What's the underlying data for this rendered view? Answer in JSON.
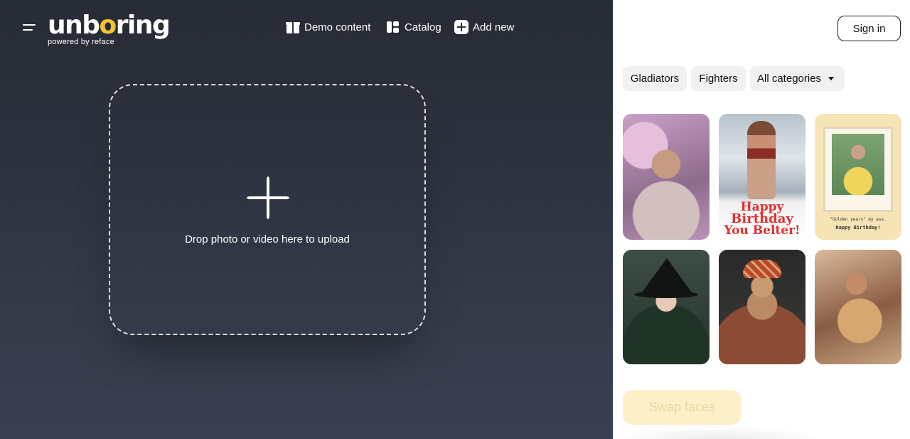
{
  "header": {
    "logo": {
      "word_start": "unb",
      "word_o": "o",
      "word_end": "ring",
      "tagline": "powered by reface"
    },
    "nav": [
      {
        "label": "Demo content",
        "icon": "gift-icon"
      },
      {
        "label": "Catalog",
        "icon": "catalog-grid-icon"
      },
      {
        "label": "Add new",
        "icon": "add-square-icon"
      }
    ],
    "sign_in_label": "Sign in"
  },
  "upload": {
    "text": "Drop photo or video here to upload",
    "icon": "plus-sparkle-icon"
  },
  "filters": [
    {
      "label": "Gladiators"
    },
    {
      "label": "Fighters"
    },
    {
      "label": "All categories",
      "icon": "caret-down-icon"
    }
  ],
  "gallery": {
    "thumbs": [
      {
        "name": "woman-in-flowers"
      },
      {
        "name": "birthday-card",
        "caption": [
          "Happy",
          "Birthday",
          "You Belter!"
        ]
      },
      {
        "name": "golden-years-card",
        "caption": [
          "\"Golden years\" my ass.",
          "Happy Birthday!"
        ]
      },
      {
        "name": "witch-hat"
      },
      {
        "name": "man-with-turban"
      },
      {
        "name": "dancer"
      }
    ]
  },
  "actions": {
    "swap_label": "Swap faces"
  },
  "colors": {
    "accent": "#f4c531",
    "dark_bg": "#2f3442",
    "swap_bg": "#fdf0c9"
  }
}
